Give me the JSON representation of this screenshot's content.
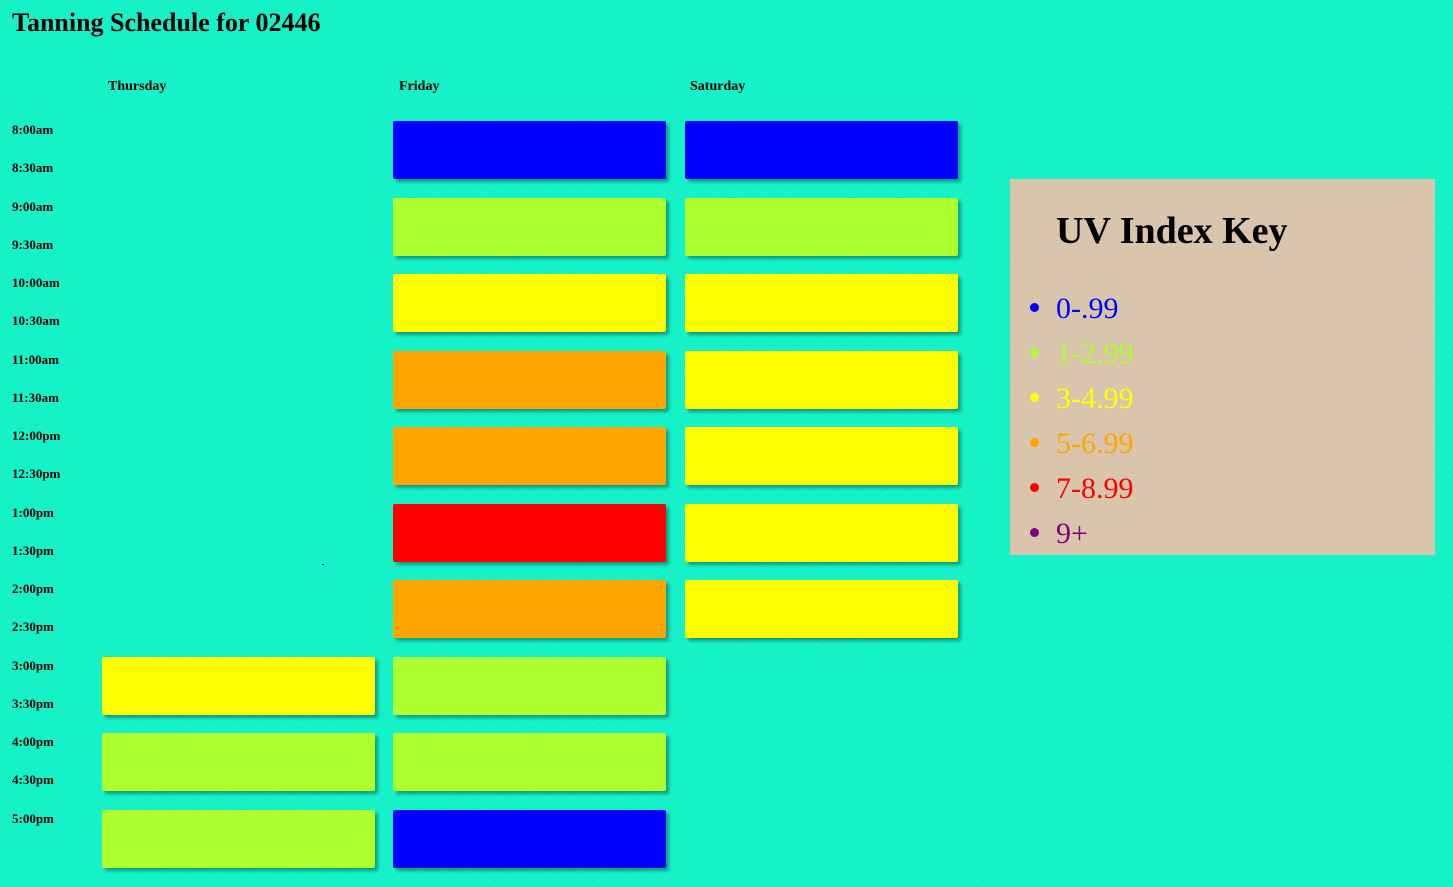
{
  "title": "Tanning Schedule for 02446",
  "days": [
    "Thursday",
    "Friday",
    "Saturday"
  ],
  "times": [
    "8:00am",
    "8:30am",
    "9:00am",
    "9:30am",
    "10:00am",
    "10:30am",
    "11:00am",
    "11:30am",
    "12:00pm",
    "12:30pm",
    "1:00pm",
    "1:30pm",
    "2:00pm",
    "2:30pm",
    "3:00pm",
    "3:30pm",
    "4:00pm",
    "4:30pm",
    "5:00pm"
  ],
  "colors": {
    "blue": "#0000ff",
    "yellowgreen": "#adff2f",
    "yellow": "#ffff00",
    "orange": "#ffa500",
    "red": "#ff0000",
    "purple": "#800080"
  },
  "schedule": [
    [
      null,
      null,
      null,
      null,
      null,
      null,
      null,
      "yellow",
      "yellowgreen",
      "yellowgreen"
    ],
    [
      "blue",
      "yellowgreen",
      "yellow",
      "orange",
      "orange",
      "red",
      "orange",
      "yellowgreen",
      "yellowgreen",
      "blue"
    ],
    [
      "blue",
      "yellowgreen",
      "yellow",
      "yellow",
      "yellow",
      "yellow",
      "yellow",
      null,
      null,
      null
    ]
  ],
  "legend": {
    "title": "UV Index Key",
    "items": [
      {
        "label": "0-.99",
        "color": "#0000ff"
      },
      {
        "label": "1-2.99",
        "color": "#adff2f"
      },
      {
        "label": "3-4.99",
        "color": "#ffff00"
      },
      {
        "label": "5-6.99",
        "color": "#ffa500"
      },
      {
        "label": "7-8.99",
        "color": "#ff0000"
      },
      {
        "label": "9+",
        "color": "#800080"
      }
    ]
  }
}
